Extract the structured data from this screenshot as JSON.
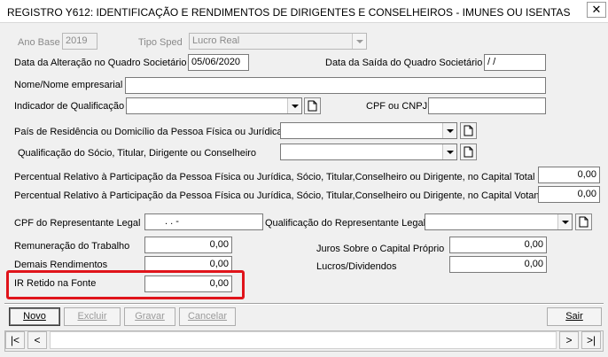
{
  "window": {
    "title": "REGISTRO Y612: IDENTIFICAÇÃO E RENDIMENTOS DE DIRIGENTES E CONSELHEIROS - IMUNES OU ISENTAS",
    "close_label": "✕"
  },
  "form": {
    "ano_base": {
      "label": "Ano Base",
      "value": "2019"
    },
    "tipo_sped": {
      "label": "Tipo Sped",
      "value": "Lucro Real"
    },
    "data_alteracao": {
      "label": "Data da Alteração no Quadro Societário",
      "value": "05/06/2020"
    },
    "data_saida": {
      "label": "Data da Saída do Quadro Societário",
      "value": " /  /"
    },
    "nome": {
      "label": "Nome/Nome empresarial",
      "value": ""
    },
    "indicador": {
      "label": "Indicador de Qualificação",
      "value": ""
    },
    "cpf_cnpj": {
      "label": "CPF ou CNPJ",
      "value": ""
    },
    "pais": {
      "label": "País de Residência ou Domicílio da Pessoa Física ou Jurídica",
      "value": ""
    },
    "qualificacao_socio": {
      "label": "Qualificação do Sócio, Titular, Dirigente ou Conselheiro",
      "value": ""
    },
    "perc_total": {
      "label": "Percentual Relativo à Participação da Pessoa Física ou Jurídica, Sócio, Titular,Conselheiro ou Dirigente, no Capital Total",
      "value": "0,00"
    },
    "perc_votante": {
      "label": "Percentual Relativo à Participação da Pessoa Física ou Jurídica, Sócio, Titular,Conselheiro ou Dirigente, no Capital Votante",
      "value": "0,00"
    },
    "cpf_representante": {
      "label": "CPF do Representante Legal",
      "value": ".   .   -"
    },
    "qualificacao_representante": {
      "label": "Qualificação do Representante Legal",
      "value": ""
    },
    "remuneracao": {
      "label": "Remuneração do Trabalho",
      "value": "0,00"
    },
    "demais": {
      "label": "Demais Rendimentos",
      "value": "0,00"
    },
    "ir_retido": {
      "label": "IR Retido na Fonte",
      "value": "0,00"
    },
    "juros": {
      "label": "Juros Sobre o Capital Próprio",
      "value": "0,00"
    },
    "lucros": {
      "label": "Lucros/Dividendos",
      "value": "0,00"
    }
  },
  "actions": {
    "novo": "Novo",
    "excluir": "Excluir",
    "gravar": "Gravar",
    "cancelar": "Cancelar",
    "sair": "Sair"
  },
  "nav": {
    "first": "|<",
    "prev": "<",
    "next": ">",
    "last": ">|"
  },
  "colors": {
    "highlight": "#e0141b",
    "window_bg": "#f0f0f0",
    "border": "#7a7a7a"
  }
}
